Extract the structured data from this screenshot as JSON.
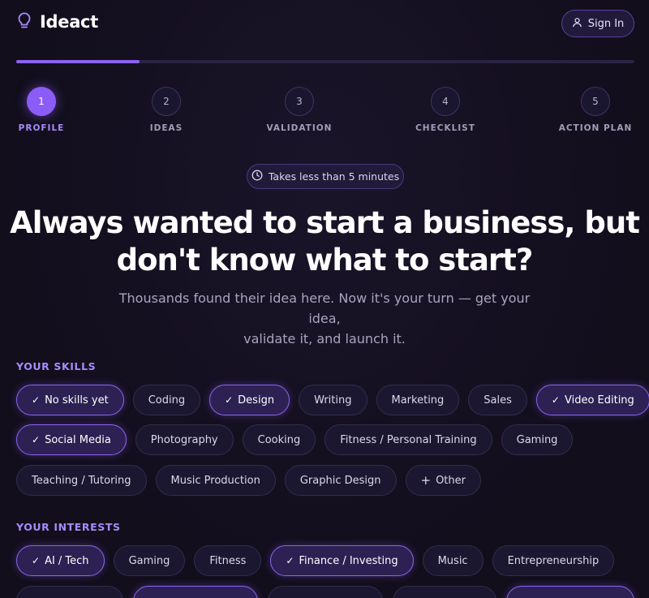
{
  "header": {
    "brand": "Ideact",
    "signin_label": "Sign In"
  },
  "progress": {
    "fraction": 0.2
  },
  "steps": [
    {
      "number": "1",
      "label": "PROFILE",
      "active": true
    },
    {
      "number": "2",
      "label": "IDEAS",
      "active": false
    },
    {
      "number": "3",
      "label": "VALIDATION",
      "active": false
    },
    {
      "number": "4",
      "label": "CHECKLIST",
      "active": false
    },
    {
      "number": "5",
      "label": "ACTION PLAN",
      "active": false
    }
  ],
  "badge": "Takes less than 5 minutes",
  "headline": {
    "line1": "Always wanted to start a business, but",
    "line2": "don't know what to start?"
  },
  "subline": {
    "line1": "Thousands found their idea here. Now it's your turn — get your idea,",
    "line2": "validate it, and launch it."
  },
  "skills": {
    "title": "YOUR SKILLS",
    "rows": [
      [
        {
          "label": "No skills yet",
          "selected": true
        },
        {
          "label": "Coding",
          "selected": false
        },
        {
          "label": "Design",
          "selected": true
        },
        {
          "label": "Writing",
          "selected": false
        },
        {
          "label": "Marketing",
          "selected": false
        },
        {
          "label": "Sales",
          "selected": false
        },
        {
          "label": "Video Editing",
          "selected": true
        }
      ],
      [
        {
          "label": "Social Media",
          "selected": true
        },
        {
          "label": "Photography",
          "selected": false
        },
        {
          "label": "Cooking",
          "selected": false
        },
        {
          "label": "Fitness / Personal Training",
          "selected": false
        },
        {
          "label": "Gaming",
          "selected": false
        }
      ],
      [
        {
          "label": "Teaching / Tutoring",
          "selected": false
        },
        {
          "label": "Music Production",
          "selected": false
        },
        {
          "label": "Graphic Design",
          "selected": false
        },
        {
          "label": "Other",
          "selected": false,
          "icon": "plus-icon"
        }
      ]
    ]
  },
  "interests": {
    "title": "YOUR INTERESTS",
    "rows": [
      [
        {
          "label": "AI / Tech",
          "selected": true
        },
        {
          "label": "Gaming",
          "selected": false
        },
        {
          "label": "Fitness",
          "selected": false
        },
        {
          "label": "Finance / Investing",
          "selected": true
        },
        {
          "label": "Music",
          "selected": false
        },
        {
          "label": "Entrepreneurship",
          "selected": false
        }
      ]
    ]
  },
  "colors": {
    "accent": "#8b5cf6",
    "background": "#130f1f"
  }
}
